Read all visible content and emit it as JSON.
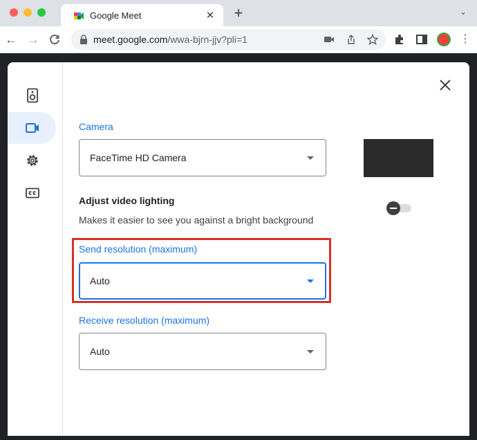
{
  "browser": {
    "tab_title": "Google Meet",
    "tab_close": "✕",
    "new_tab": "+",
    "url_host": "meet.google.com",
    "url_path": "/wwa-bjrn-jjv?pli=1"
  },
  "settings": {
    "nav_items": [
      {
        "name": "audio",
        "icon": "speaker-icon",
        "active": false
      },
      {
        "name": "video",
        "icon": "video-camera-icon",
        "active": true
      },
      {
        "name": "general",
        "icon": "gear-icon",
        "active": false
      },
      {
        "name": "captions",
        "icon": "closed-captions-icon",
        "active": false
      }
    ],
    "camera": {
      "label": "Camera",
      "selected": "FaceTime HD Camera"
    },
    "lighting": {
      "heading": "Adjust video lighting",
      "description": "Makes it easier to see you against a bright background",
      "enabled": false
    },
    "send_resolution": {
      "label": "Send resolution (maximum)",
      "selected": "Auto"
    },
    "receive_resolution": {
      "label": "Receive resolution (maximum)",
      "selected": "Auto"
    }
  },
  "colors": {
    "accent": "#1a73e8",
    "highlight_box": "#d93025",
    "active_nav_bg": "#e8f0fe"
  }
}
